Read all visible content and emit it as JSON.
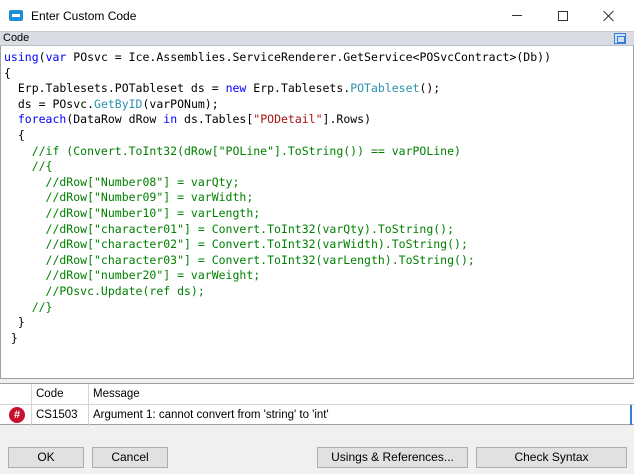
{
  "window": {
    "title": "Enter Custom Code",
    "icon": "window-app-icon"
  },
  "editor": {
    "header": "Code",
    "lines": [
      [
        {
          "t": "using",
          "c": "k"
        },
        {
          "t": "(",
          "c": ""
        },
        {
          "t": "var",
          "c": "k"
        },
        {
          "t": " POsvc = Ice.Assemblies.ServiceRenderer.GetService<POSvcContract>(Db))",
          "c": ""
        }
      ],
      [
        {
          "t": "{",
          "c": ""
        }
      ],
      [
        {
          "t": "  Erp.Tablesets.POTableset ds = ",
          "c": ""
        },
        {
          "t": "new",
          "c": "k"
        },
        {
          "t": " Erp.Tablesets.",
          "c": ""
        },
        {
          "t": "POTableset",
          "c": "t"
        },
        {
          "t": "();",
          "c": ""
        }
      ],
      [
        {
          "t": "  ds = POsvc.",
          "c": ""
        },
        {
          "t": "GetByID",
          "c": "t"
        },
        {
          "t": "(varPONum);",
          "c": ""
        }
      ],
      [
        {
          "t": "  ",
          "c": ""
        },
        {
          "t": "foreach",
          "c": "k"
        },
        {
          "t": "(DataRow dRow ",
          "c": ""
        },
        {
          "t": "in",
          "c": "k"
        },
        {
          "t": " ds.Tables[",
          "c": ""
        },
        {
          "t": "\"PODetail\"",
          "c": "s"
        },
        {
          "t": "].Rows)",
          "c": ""
        }
      ],
      [
        {
          "t": "  {",
          "c": ""
        }
      ],
      [
        {
          "t": "    //if (Convert.ToInt32(dRow[\"POLine\"].ToString()) == varPOLine)",
          "c": "c"
        }
      ],
      [
        {
          "t": "    //{",
          "c": "c"
        }
      ],
      [
        {
          "t": "      //dRow[\"Number08\"] = varQty;",
          "c": "c"
        }
      ],
      [
        {
          "t": "      //dRow[\"Number09\"] = varWidth;",
          "c": "c"
        }
      ],
      [
        {
          "t": "      //dRow[\"Number10\"] = varLength;",
          "c": "c"
        }
      ],
      [
        {
          "t": "      //dRow[\"character01\"] = Convert.ToInt32(varQty).ToString();",
          "c": "c"
        }
      ],
      [
        {
          "t": "      //dRow[\"character02\"] = Convert.ToInt32(varWidth).ToString();",
          "c": "c"
        }
      ],
      [
        {
          "t": "      //dRow[\"character03\"] = Convert.ToInt32(varLength).ToString();",
          "c": "c"
        }
      ],
      [
        {
          "t": "      //dRow[\"number20\"] = varWeight;",
          "c": "c"
        }
      ],
      [
        {
          "t": "      //POsvc.Update(ref ds);",
          "c": "c"
        }
      ],
      [
        {
          "t": "    //}",
          "c": "c"
        }
      ],
      [
        {
          "t": "  }",
          "c": ""
        }
      ],
      [
        {
          "t": " }",
          "c": ""
        }
      ]
    ]
  },
  "errors": {
    "columns": {
      "code": "Code",
      "message": "Message"
    },
    "rows": [
      {
        "icon": "error-hash-icon",
        "glyph": "#",
        "code": "CS1503",
        "message": "Argument 1: cannot convert from 'string' to 'int'"
      }
    ]
  },
  "buttons": {
    "ok": "OK",
    "cancel": "Cancel",
    "usings": "Usings & References...",
    "check_syntax": "Check Syntax"
  }
}
